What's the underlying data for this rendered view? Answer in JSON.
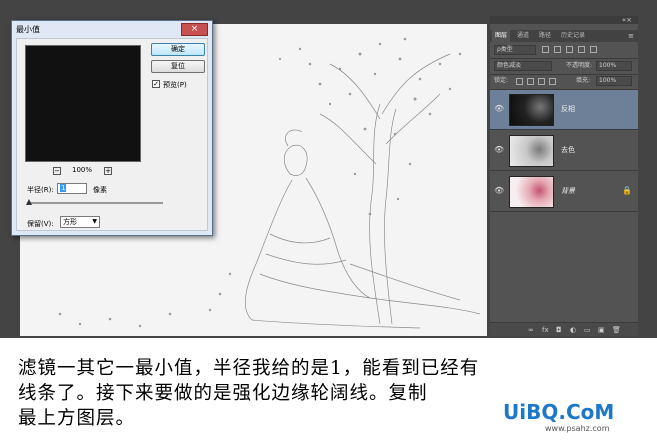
{
  "dialog": {
    "title": "最小值",
    "close_label": "×",
    "ok_label": "确定",
    "reset_label": "复位",
    "preview_checked": true,
    "preview_label": "预览(P)",
    "zoom_minus": "−",
    "zoom_value": "100%",
    "zoom_plus": "+",
    "radius_label": "半径(R):",
    "radius_value": "1",
    "radius_unit": "像素",
    "keep_label": "保留(V):",
    "keep_value": "方形"
  },
  "layers_panel": {
    "tabs": [
      {
        "label": "图层",
        "active": true
      },
      {
        "label": "通道",
        "active": false
      },
      {
        "label": "路径",
        "active": false
      },
      {
        "label": "历史记录",
        "active": false
      }
    ],
    "filter_kind": "ρ类型",
    "blend_mode": "颜色减淡",
    "opacity_label": "不透明度:",
    "opacity_value": "100%",
    "lock_label": "锁定:",
    "fill_label": "填充:",
    "fill_value": "100%",
    "layers": [
      {
        "name": "反相",
        "selected": true,
        "locked": false
      },
      {
        "name": "去色",
        "selected": false,
        "locked": false
      },
      {
        "name": "背景",
        "selected": false,
        "locked": true
      }
    ]
  },
  "caption": {
    "line1": "滤镜一其它一最小值，半径我给的是1，能看到已经有",
    "line2": "线条了。接下来要做的是强化边缘轮阔线。复制",
    "line3": "最上方图层。"
  },
  "watermark": {
    "brand": "UiBQ.CoM",
    "url": "www.psahz.com"
  },
  "colors": {
    "workspace": "#444444",
    "panel": "#535353",
    "selected_layer": "#6d8098",
    "dialog_frame": "#dfe8f4",
    "watermark": "#1e78c8"
  }
}
